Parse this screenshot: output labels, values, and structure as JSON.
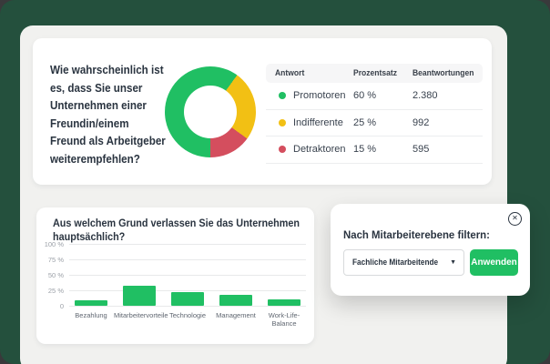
{
  "theme": {
    "backdrop": "#39393B",
    "brand_green_bg": "#24503D",
    "panel_bg": "#F1F1EF",
    "card_bg": "#FFFFFF",
    "accent_green": "#20BF63",
    "accent_yellow": "#F2C014",
    "accent_red": "#D44E5E",
    "text_dark": "#2A3440",
    "axis_gray": "#9CA1A8"
  },
  "nps_card": {
    "question_lines": [
      "Wie wahrscheinlich ist",
      "es, dass Sie unser",
      "Unternehmen einer",
      "Freundin/einem",
      "Freund als Arbeitgeber",
      "weiterempfehlen?"
    ],
    "table": {
      "headers": [
        "Antwort",
        "Prozentsatz",
        "Beantwortungen"
      ],
      "rows": [
        {
          "dot_color": "#20BF63",
          "label": "Promotoren",
          "percent": "60 %",
          "responses": "2.380"
        },
        {
          "dot_color": "#F2C014",
          "label": "Indifferente",
          "percent": "25 %",
          "responses": "992"
        },
        {
          "dot_color": "#D44E5E",
          "label": "Detraktoren",
          "percent": "15 %",
          "responses": "595"
        }
      ]
    }
  },
  "chart_data": [
    {
      "type": "pie",
      "donut": true,
      "title": "Wie wahrscheinlich ist es, dass Sie unser Unternehmen einer Freundin/einem Freund als Arbeitgeber weiterempfehlen?",
      "labels": [
        "Indifferente",
        "Detraktoren",
        "Promotoren"
      ],
      "values": [
        25,
        15,
        60
      ],
      "colors": [
        "#F2C014",
        "#D44E5E",
        "#20BF63"
      ],
      "start_angle_deg": 36,
      "legend_position": "table-right"
    },
    {
      "type": "bar",
      "title": "Aus welchem Grund verlassen Sie das Unternehmen hauptsächlich?",
      "categories": [
        "Bezahlung",
        "Mitarbeitervorteile",
        "Technologie",
        "Management",
        "Work-Life-Balance"
      ],
      "values": [
        9,
        33,
        22,
        17,
        10
      ],
      "unit": "%",
      "ylim": [
        0,
        100
      ],
      "yticks_labels": [
        "100 %",
        "75 %",
        "50 %",
        "25 %",
        "0"
      ],
      "yticks_values": [
        100,
        75,
        50,
        25,
        0
      ],
      "bar_color": "#20BF63",
      "grid": true
    }
  ],
  "bar_card": {
    "title_lines": [
      "Aus welchem Grund verlassen Sie das Unternehmen",
      "hauptsächlich?"
    ]
  },
  "filter_popup": {
    "title": "Nach Mitarbeiterebene filtern:",
    "dropdown_value": "Fachliche Mitarbeitende",
    "dropdown_arrow_glyph": "▼",
    "apply_label": "Anwenden",
    "close_icon_glyph": "✕"
  }
}
